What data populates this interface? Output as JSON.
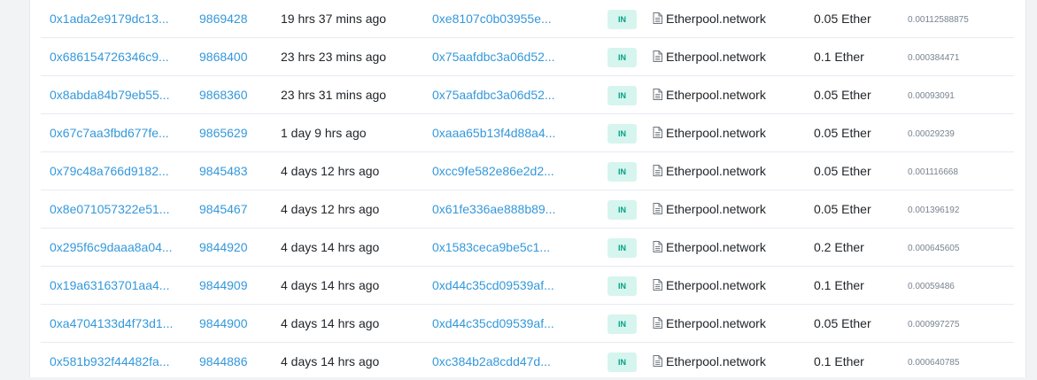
{
  "transactions": [
    {
      "txhash": "0x1ada2e9179dc13...",
      "block": "9869428",
      "age": "19 hrs 37 mins ago",
      "from": "0xe8107c0b03955e...",
      "direction": "IN",
      "to": "Etherpool.network",
      "value": "0.05 Ether",
      "fee": "0.00112588875"
    },
    {
      "txhash": "0x686154726346c9...",
      "block": "9868400",
      "age": "23 hrs 23 mins ago",
      "from": "0x75aafdbc3a06d52...",
      "direction": "IN",
      "to": "Etherpool.network",
      "value": "0.1 Ether",
      "fee": "0.000384471"
    },
    {
      "txhash": "0x8abda84b79eb55...",
      "block": "9868360",
      "age": "23 hrs 31 mins ago",
      "from": "0x75aafdbc3a06d52...",
      "direction": "IN",
      "to": "Etherpool.network",
      "value": "0.05 Ether",
      "fee": "0.00093091"
    },
    {
      "txhash": "0x67c7aa3fbd677fe...",
      "block": "9865629",
      "age": "1 day 9 hrs ago",
      "from": "0xaaa65b13f4d88a4...",
      "direction": "IN",
      "to": "Etherpool.network",
      "value": "0.05 Ether",
      "fee": "0.00029239"
    },
    {
      "txhash": "0x79c48a766d9182...",
      "block": "9845483",
      "age": "4 days 12 hrs ago",
      "from": "0xcc9fe582e86e2d2...",
      "direction": "IN",
      "to": "Etherpool.network",
      "value": "0.05 Ether",
      "fee": "0.001116668"
    },
    {
      "txhash": "0x8e071057322e51...",
      "block": "9845467",
      "age": "4 days 12 hrs ago",
      "from": "0x61fe336ae888b89...",
      "direction": "IN",
      "to": "Etherpool.network",
      "value": "0.05 Ether",
      "fee": "0.001396192"
    },
    {
      "txhash": "0x295f6c9daaa8a04...",
      "block": "9844920",
      "age": "4 days 14 hrs ago",
      "from": "0x1583ceca9be5c1...",
      "direction": "IN",
      "to": "Etherpool.network",
      "value": "0.2 Ether",
      "fee": "0.000645605"
    },
    {
      "txhash": "0x19a63163701aa4...",
      "block": "9844909",
      "age": "4 days 14 hrs ago",
      "from": "0xd44c35cd09539af...",
      "direction": "IN",
      "to": "Etherpool.network",
      "value": "0.1 Ether",
      "fee": "0.00059486"
    },
    {
      "txhash": "0xa4704133d4f73d1...",
      "block": "9844900",
      "age": "4 days 14 hrs ago",
      "from": "0xd44c35cd09539af...",
      "direction": "IN",
      "to": "Etherpool.network",
      "value": "0.05 Ether",
      "fee": "0.000997275"
    },
    {
      "txhash": "0x581b932f44482fa...",
      "block": "9844886",
      "age": "4 days 14 hrs ago",
      "from": "0xc384b2a8cdd47d...",
      "direction": "IN",
      "to": "Etherpool.network",
      "value": "0.1 Ether",
      "fee": "0.000640785"
    }
  ],
  "colors": {
    "link": "#3498db",
    "badge_bg": "#d6f5ee",
    "badge_text": "#00a186",
    "text": "#212529",
    "muted": "#77838f"
  },
  "icons": {
    "contract": "document-icon"
  }
}
